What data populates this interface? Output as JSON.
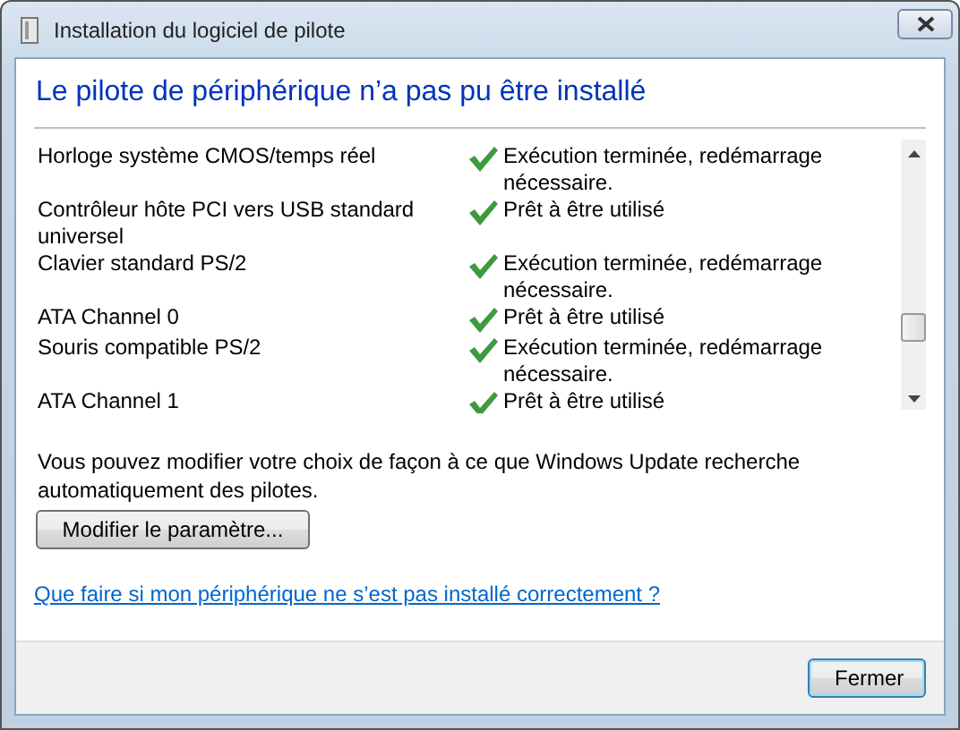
{
  "window": {
    "title": "Installation du logiciel de pilote"
  },
  "heading": "Le pilote de périphérique n’a pas pu être installé",
  "devices": [
    {
      "name": "Horloge système CMOS/temps réel",
      "status": "Exécution terminée, redémarrage nécessaire."
    },
    {
      "name": "Contrôleur hôte PCI vers USB standard universel",
      "status": "Prêt à être utilisé"
    },
    {
      "name": "Clavier standard PS/2",
      "status": "Exécution terminée, redémarrage nécessaire."
    },
    {
      "name": "ATA Channel 0",
      "status": "Prêt à être utilisé"
    },
    {
      "name": "Souris compatible PS/2",
      "status": "Exécution terminée, redémarrage nécessaire."
    },
    {
      "name": "ATA Channel 1",
      "status": "Prêt à être utilisé"
    }
  ],
  "info": "Vous pouvez modifier votre choix de façon à ce que Windows Update recherche automatiquement des pilotes.",
  "settings_button": "Modifier le paramètre...",
  "help_link": "Que faire si mon périphérique ne s’est pas installé correctement ?",
  "buttons": [
    {
      "label": "Fermer",
      "focused": true
    }
  ]
}
